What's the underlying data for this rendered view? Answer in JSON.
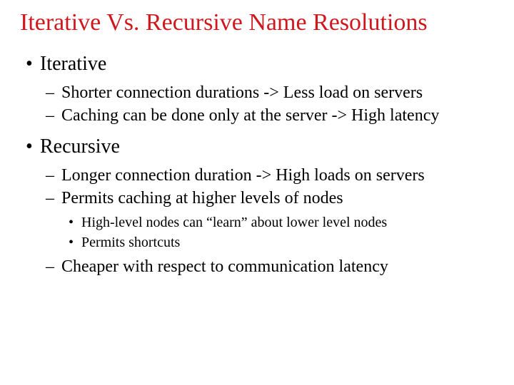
{
  "colors": {
    "title": "#ce181e",
    "body": "#000000"
  },
  "title": "Iterative Vs. Recursive Name Resolutions",
  "sections": [
    {
      "heading": "Iterative",
      "points": [
        {
          "text": "Shorter connection durations -> Less load on servers"
        },
        {
          "text": "Caching can be done only at the server -> High latency"
        }
      ]
    },
    {
      "heading": "Recursive",
      "points": [
        {
          "text": "Longer connection duration -> High loads on servers"
        },
        {
          "text": "Permits caching at higher levels of nodes",
          "sub": [
            "High-level nodes can “learn” about lower level nodes",
            "Permits shortcuts"
          ]
        },
        {
          "text": "Cheaper with respect to communication latency"
        }
      ]
    }
  ]
}
